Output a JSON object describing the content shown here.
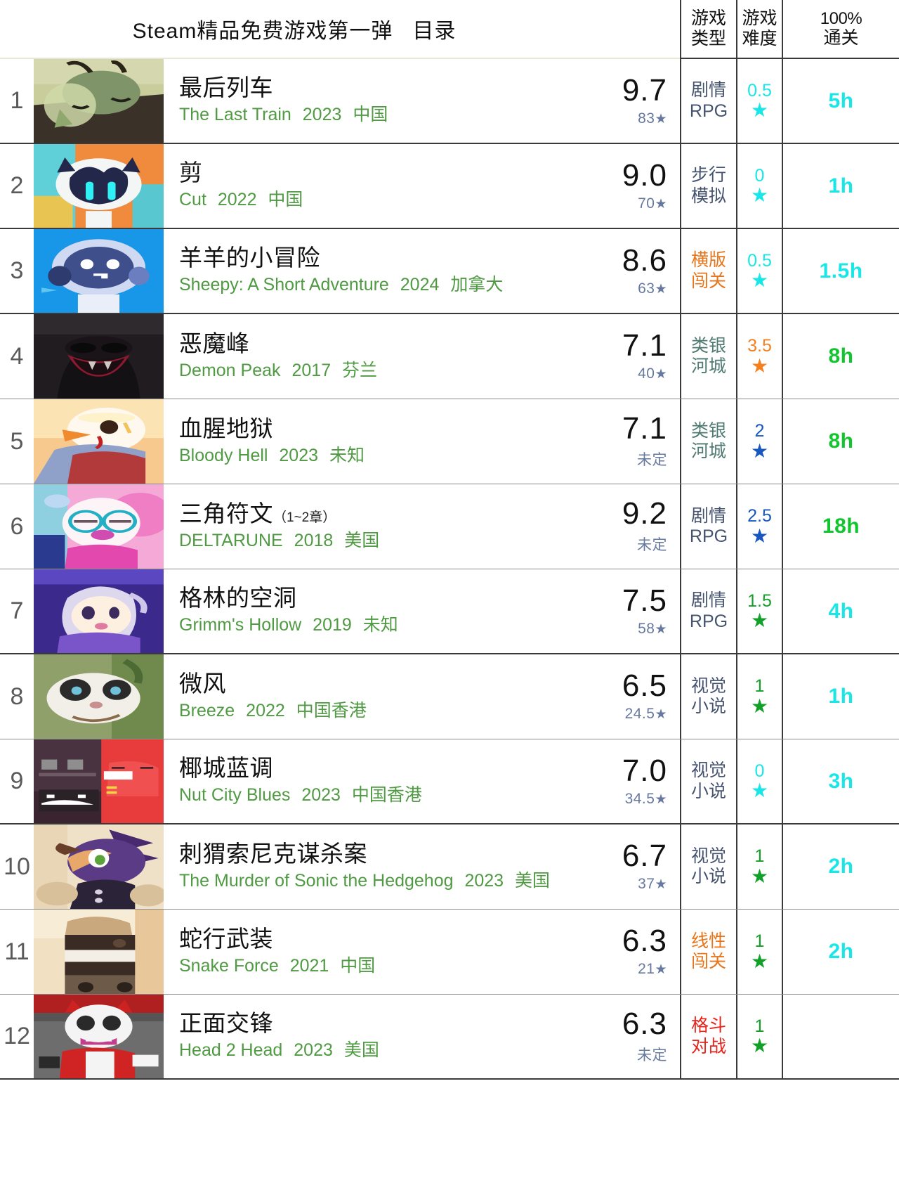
{
  "header": {
    "title_main": "Steam精品免费游戏第一弹",
    "title_sub": "目录",
    "col_type_l1": "游戏",
    "col_type_l2": "类型",
    "col_diff_l1": "游戏",
    "col_diff_l2": "难度",
    "col_clear_l1": "100%",
    "col_clear_l2": "通关"
  },
  "colors": {
    "title_en": "#4f9a42",
    "score_sub": "#67799e",
    "type_blue": "#46536f",
    "type_teal": "#4f7a72",
    "type_orange": "#e8751a",
    "type_red": "#e8231a",
    "diff_cyan": "#19e6e6",
    "diff_green": "#12a029",
    "diff_blue": "#1757bf",
    "diff_orange": "#f5801f",
    "clear_cyan": "#19e6e6",
    "clear_green": "#12c42e",
    "rank": "#5a5a5a"
  },
  "rows": [
    {
      "rank": "1",
      "title_cn": "最后列车",
      "title_suffix": "",
      "title_en": "The Last Train",
      "year": "2023",
      "region": "中国",
      "score": "9.7",
      "reviews": "83",
      "reviews_star": true,
      "type_l1": "剧情",
      "type_l2": "RPG",
      "type_color": "type_blue",
      "difficulty": "0.5",
      "difficulty_color": "diff_cyan",
      "clear_time": "5h",
      "clear_color": "clear_cyan",
      "art": "last-train"
    },
    {
      "rank": "2",
      "title_cn": "剪",
      "title_suffix": "",
      "title_en": "Cut",
      "year": "2022",
      "region": "中国",
      "score": "9.0",
      "reviews": "70",
      "reviews_star": true,
      "type_l1": "步行",
      "type_l2": "模拟",
      "type_color": "type_blue",
      "difficulty": "0",
      "difficulty_color": "diff_cyan",
      "clear_time": "1h",
      "clear_color": "clear_cyan",
      "art": "cut"
    },
    {
      "rank": "3",
      "title_cn": "羊羊的小冒险",
      "title_suffix": "",
      "title_en": "Sheepy: A Short Adventure",
      "year": "2024",
      "region": "加拿大",
      "score": "8.6",
      "reviews": "63",
      "reviews_star": true,
      "type_l1": "横版",
      "type_l2": "闯关",
      "type_color": "type_orange",
      "difficulty": "0.5",
      "difficulty_color": "diff_cyan",
      "clear_time": "1.5h",
      "clear_color": "clear_cyan",
      "art": "sheepy"
    },
    {
      "rank": "4",
      "title_cn": "恶魔峰",
      "title_suffix": "",
      "title_en": "Demon Peak",
      "year": "2017",
      "region": "芬兰",
      "score": "7.1",
      "reviews": "40",
      "reviews_star": true,
      "type_l1": "类银",
      "type_l2": "河城",
      "type_color": "type_teal",
      "difficulty": "3.5",
      "difficulty_color": "diff_orange",
      "clear_time": "8h",
      "clear_color": "clear_green",
      "art": "demon-peak"
    },
    {
      "rank": "5",
      "title_cn": "血腥地狱",
      "title_suffix": "",
      "title_en": "Bloody Hell",
      "year": "2023",
      "region": "未知",
      "score": "7.1",
      "reviews": "未定",
      "reviews_star": false,
      "type_l1": "类银",
      "type_l2": "河城",
      "type_color": "type_teal",
      "difficulty": "2",
      "difficulty_color": "diff_blue",
      "clear_time": "8h",
      "clear_color": "clear_green",
      "art": "bloody-hell"
    },
    {
      "rank": "6",
      "title_cn": "三角符文",
      "title_suffix": "（1~2章）",
      "title_en": "DELTARUNE",
      "year": "2018",
      "region": "美国",
      "score": "9.2",
      "reviews": "未定",
      "reviews_star": false,
      "type_l1": "剧情",
      "type_l2": "RPG",
      "type_color": "type_blue",
      "difficulty": "2.5",
      "difficulty_color": "diff_blue",
      "clear_time": "18h",
      "clear_color": "clear_green",
      "art": "deltarune"
    },
    {
      "rank": "7",
      "title_cn": "格林的空洞",
      "title_suffix": "",
      "title_en": "Grimm's Hollow",
      "year": "2019",
      "region": "未知",
      "score": "7.5",
      "reviews": "58",
      "reviews_star": true,
      "type_l1": "剧情",
      "type_l2": "RPG",
      "type_color": "type_blue",
      "difficulty": "1.5",
      "difficulty_color": "diff_green",
      "clear_time": "4h",
      "clear_color": "clear_cyan",
      "art": "grimms-hollow"
    },
    {
      "rank": "8",
      "title_cn": "微风",
      "title_suffix": "",
      "title_en": "Breeze",
      "year": "2022",
      "region": "中国香港",
      "score": "6.5",
      "reviews": "24.5",
      "reviews_star": true,
      "type_l1": "视觉",
      "type_l2": "小说",
      "type_color": "type_blue",
      "difficulty": "1",
      "difficulty_color": "diff_green",
      "clear_time": "1h",
      "clear_color": "clear_cyan",
      "art": "breeze"
    },
    {
      "rank": "9",
      "title_cn": "椰城蓝调",
      "title_suffix": "",
      "title_en": "Nut City Blues",
      "year": "2023",
      "region": "中国香港",
      "score": "7.0",
      "reviews": "34.5",
      "reviews_star": true,
      "type_l1": "视觉",
      "type_l2": "小说",
      "type_color": "type_blue",
      "difficulty": "0",
      "difficulty_color": "diff_cyan",
      "clear_time": "3h",
      "clear_color": "clear_cyan",
      "art": "nut-city"
    },
    {
      "rank": "10",
      "title_cn": "刺猬索尼克谋杀案",
      "title_suffix": "",
      "title_en": "The Murder of Sonic the Hedgehog",
      "year": "2023",
      "region": "美国",
      "score": "6.7",
      "reviews": "37",
      "reviews_star": true,
      "type_l1": "视觉",
      "type_l2": "小说",
      "type_color": "type_blue",
      "difficulty": "1",
      "difficulty_color": "diff_green",
      "clear_time": "2h",
      "clear_color": "clear_cyan",
      "art": "sonic"
    },
    {
      "rank": "11",
      "title_cn": "蛇行武装",
      "title_suffix": "",
      "title_en": "Snake Force",
      "year": "2021",
      "region": "中国",
      "score": "6.3",
      "reviews": "21",
      "reviews_star": true,
      "type_l1": "线性",
      "type_l2": "闯关",
      "type_color": "type_orange",
      "difficulty": "1",
      "difficulty_color": "diff_green",
      "clear_time": "2h",
      "clear_color": "clear_cyan",
      "art": "snake-force"
    },
    {
      "rank": "12",
      "title_cn": "正面交锋",
      "title_suffix": "",
      "title_en": "Head 2 Head",
      "year": "2023",
      "region": "美国",
      "score": "6.3",
      "reviews": "未定",
      "reviews_star": false,
      "type_l1": "格斗",
      "type_l2": "对战",
      "type_color": "type_red",
      "difficulty": "1",
      "difficulty_color": "diff_green",
      "clear_time": "",
      "clear_color": "clear_cyan",
      "art": "head2head"
    }
  ]
}
